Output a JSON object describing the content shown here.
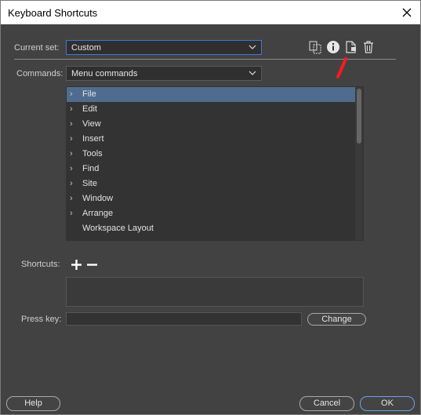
{
  "window": {
    "title": "Keyboard Shortcuts"
  },
  "current_set": {
    "label": "Current set:",
    "value": "Custom"
  },
  "commands": {
    "label": "Commands:",
    "value": "Menu commands"
  },
  "toolbar": {
    "icons": [
      "duplicate-set-icon",
      "info-icon",
      "export-set-icon",
      "delete-set-icon"
    ]
  },
  "command_list": {
    "items": [
      {
        "label": "File",
        "expandable": true,
        "selected": true
      },
      {
        "label": "Edit",
        "expandable": true
      },
      {
        "label": "View",
        "expandable": true
      },
      {
        "label": "Insert",
        "expandable": true
      },
      {
        "label": "Tools",
        "expandable": true
      },
      {
        "label": "Find",
        "expandable": true
      },
      {
        "label": "Site",
        "expandable": true
      },
      {
        "label": "Window",
        "expandable": true
      },
      {
        "label": "Arrange",
        "expandable": true
      },
      {
        "label": "Workspace Layout",
        "expandable": false
      }
    ]
  },
  "shortcuts": {
    "label": "Shortcuts:"
  },
  "press_key": {
    "label": "Press key:",
    "value": ""
  },
  "buttons": {
    "change": "Change",
    "help": "Help",
    "cancel": "Cancel",
    "ok": "OK"
  },
  "colors": {
    "accent": "#3d7bd6",
    "selection": "#4f6c8f",
    "annotation": "#ff1a1a"
  }
}
